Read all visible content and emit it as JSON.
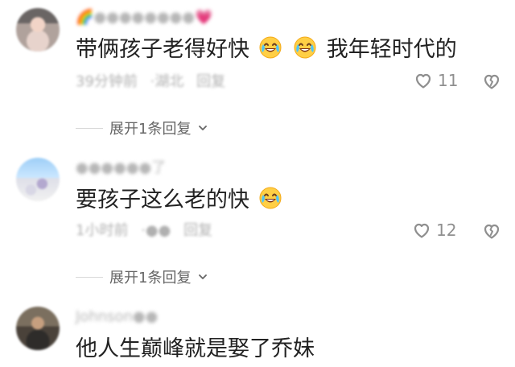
{
  "comments": [
    {
      "avatar": "blurred-avatar",
      "username": "🌈●●●●●●●●💗",
      "text_parts": [
        "带俩孩子老得好快",
        "我年轻时代的"
      ],
      "meta": [
        "39分钟前",
        "·湖北",
        "回复"
      ],
      "likes": "11",
      "reply_toggle": "展开1条回复",
      "reaction_icon": "laugh-cry-emoji"
    },
    {
      "avatar": "castle-avatar",
      "username": "●●●●●●了",
      "text_parts": [
        "要孩子这么老的快"
      ],
      "meta": [
        "1小时前",
        "·●●",
        "回复"
      ],
      "likes": "12",
      "reply_toggle": "展开1条回复",
      "reaction_icon": "laugh-cry-emoji"
    },
    {
      "avatar": "portrait-avatar",
      "username": "Johnson●●",
      "text_parts": [
        "他人生巅峰就是娶了乔妹"
      ]
    }
  ],
  "icons": {
    "like": "heart-icon",
    "dislike": "broken-heart-icon",
    "chevron": "chevron-down-icon"
  },
  "colors": {
    "text": "#222222",
    "meta": "#b0b0b0",
    "icon": "#8f8f8f",
    "divider": "#d8d8d8"
  }
}
